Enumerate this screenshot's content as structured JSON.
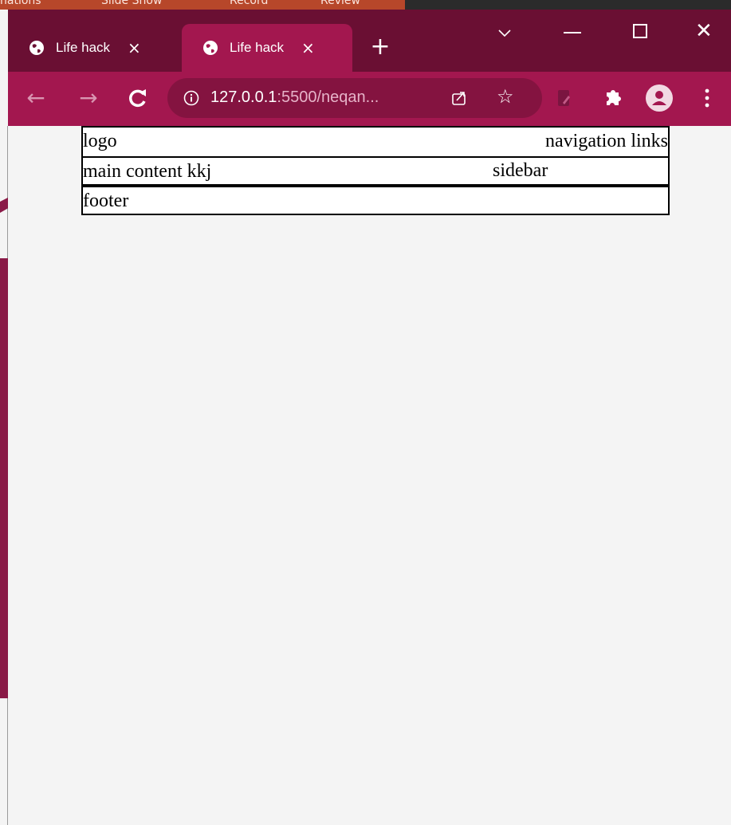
{
  "background_app": {
    "ribbon_items": [
      "nations",
      "Slide Show",
      "Record",
      "Review"
    ],
    "right_items": [
      "",
      ""
    ]
  },
  "browser": {
    "tabs": [
      {
        "title": "Life hack",
        "close": "×",
        "active": false
      },
      {
        "title": "Life hack",
        "close": "×",
        "active": true
      }
    ],
    "new_tab": "+",
    "window_close": "✕",
    "nav": {
      "back": "←",
      "forward": "→",
      "reload": "C"
    },
    "address": {
      "host": "127.0.0.1",
      "rest": ":5500/neqan..."
    },
    "bookmark_icon": "☆"
  },
  "page": {
    "header": {
      "logo": "logo",
      "nav": "navigation links"
    },
    "main": {
      "content": "main content kkj",
      "sidebar": "sidebar"
    },
    "footer": {
      "text": "footer"
    }
  },
  "colors": {
    "tabbar": "#6a0f33",
    "toolbar": "#a3174f",
    "omnibox": "#841340",
    "page_bg": "#f4f4f4"
  }
}
